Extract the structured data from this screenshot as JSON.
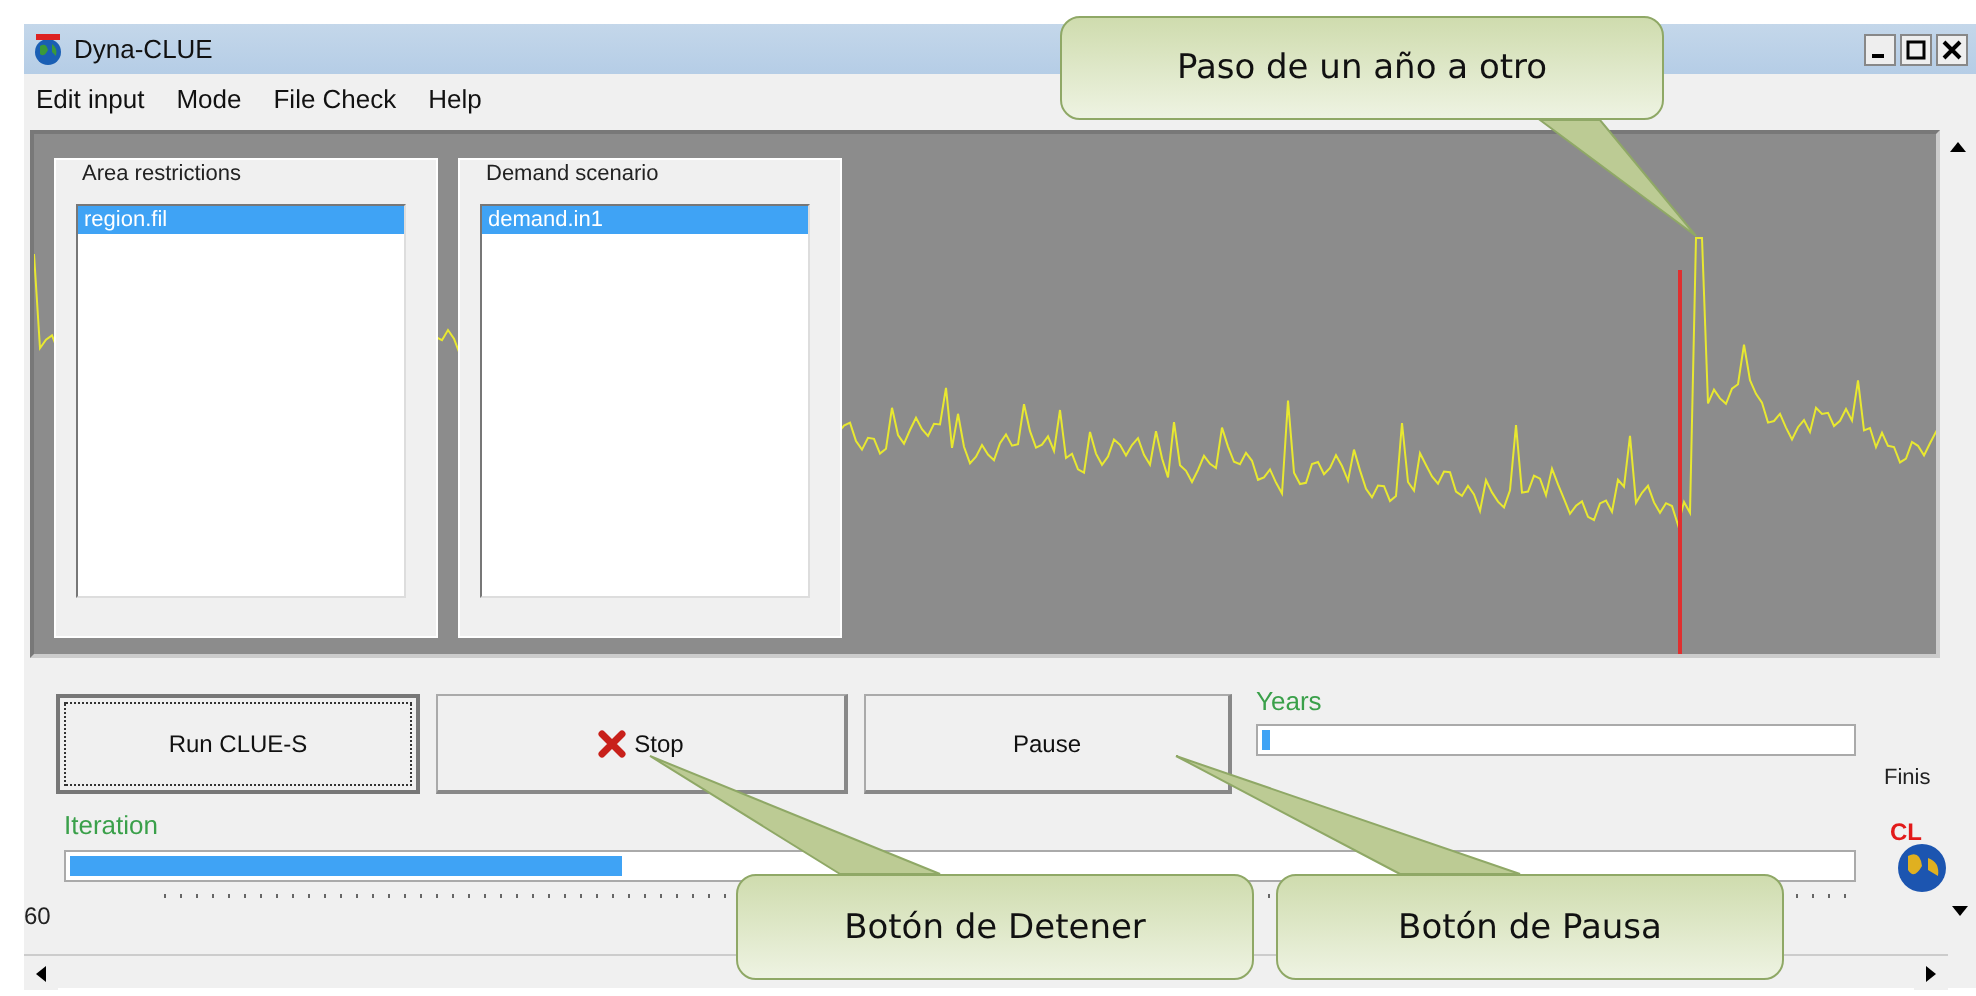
{
  "window": {
    "title": "Dyna-CLUE"
  },
  "menu": [
    "Edit input",
    "Mode",
    "File Check",
    "Help"
  ],
  "panels": [
    {
      "title": "Area restrictions",
      "items": [
        {
          "label": "region.fil",
          "selected": true
        }
      ]
    },
    {
      "title": "Demand scenario",
      "items": [
        {
          "label": "demand.in1",
          "selected": true
        }
      ]
    }
  ],
  "buttons": [
    {
      "label": "Run CLUE-S",
      "kind": "focused"
    },
    {
      "label": "Stop",
      "kind": "stop"
    },
    {
      "label": "Pause",
      "kind": "plain"
    }
  ],
  "years": {
    "label": "Years",
    "level": 0.01
  },
  "status": "Finis",
  "logo_text": "CL",
  "iteration": {
    "label": "Iteration",
    "level": 0.31
  },
  "ruler_label": "60",
  "callouts": [
    {
      "text": "Paso de un año a otro"
    },
    {
      "text": "Botón de Detener"
    },
    {
      "text": "Botón de Pausa"
    }
  ]
}
